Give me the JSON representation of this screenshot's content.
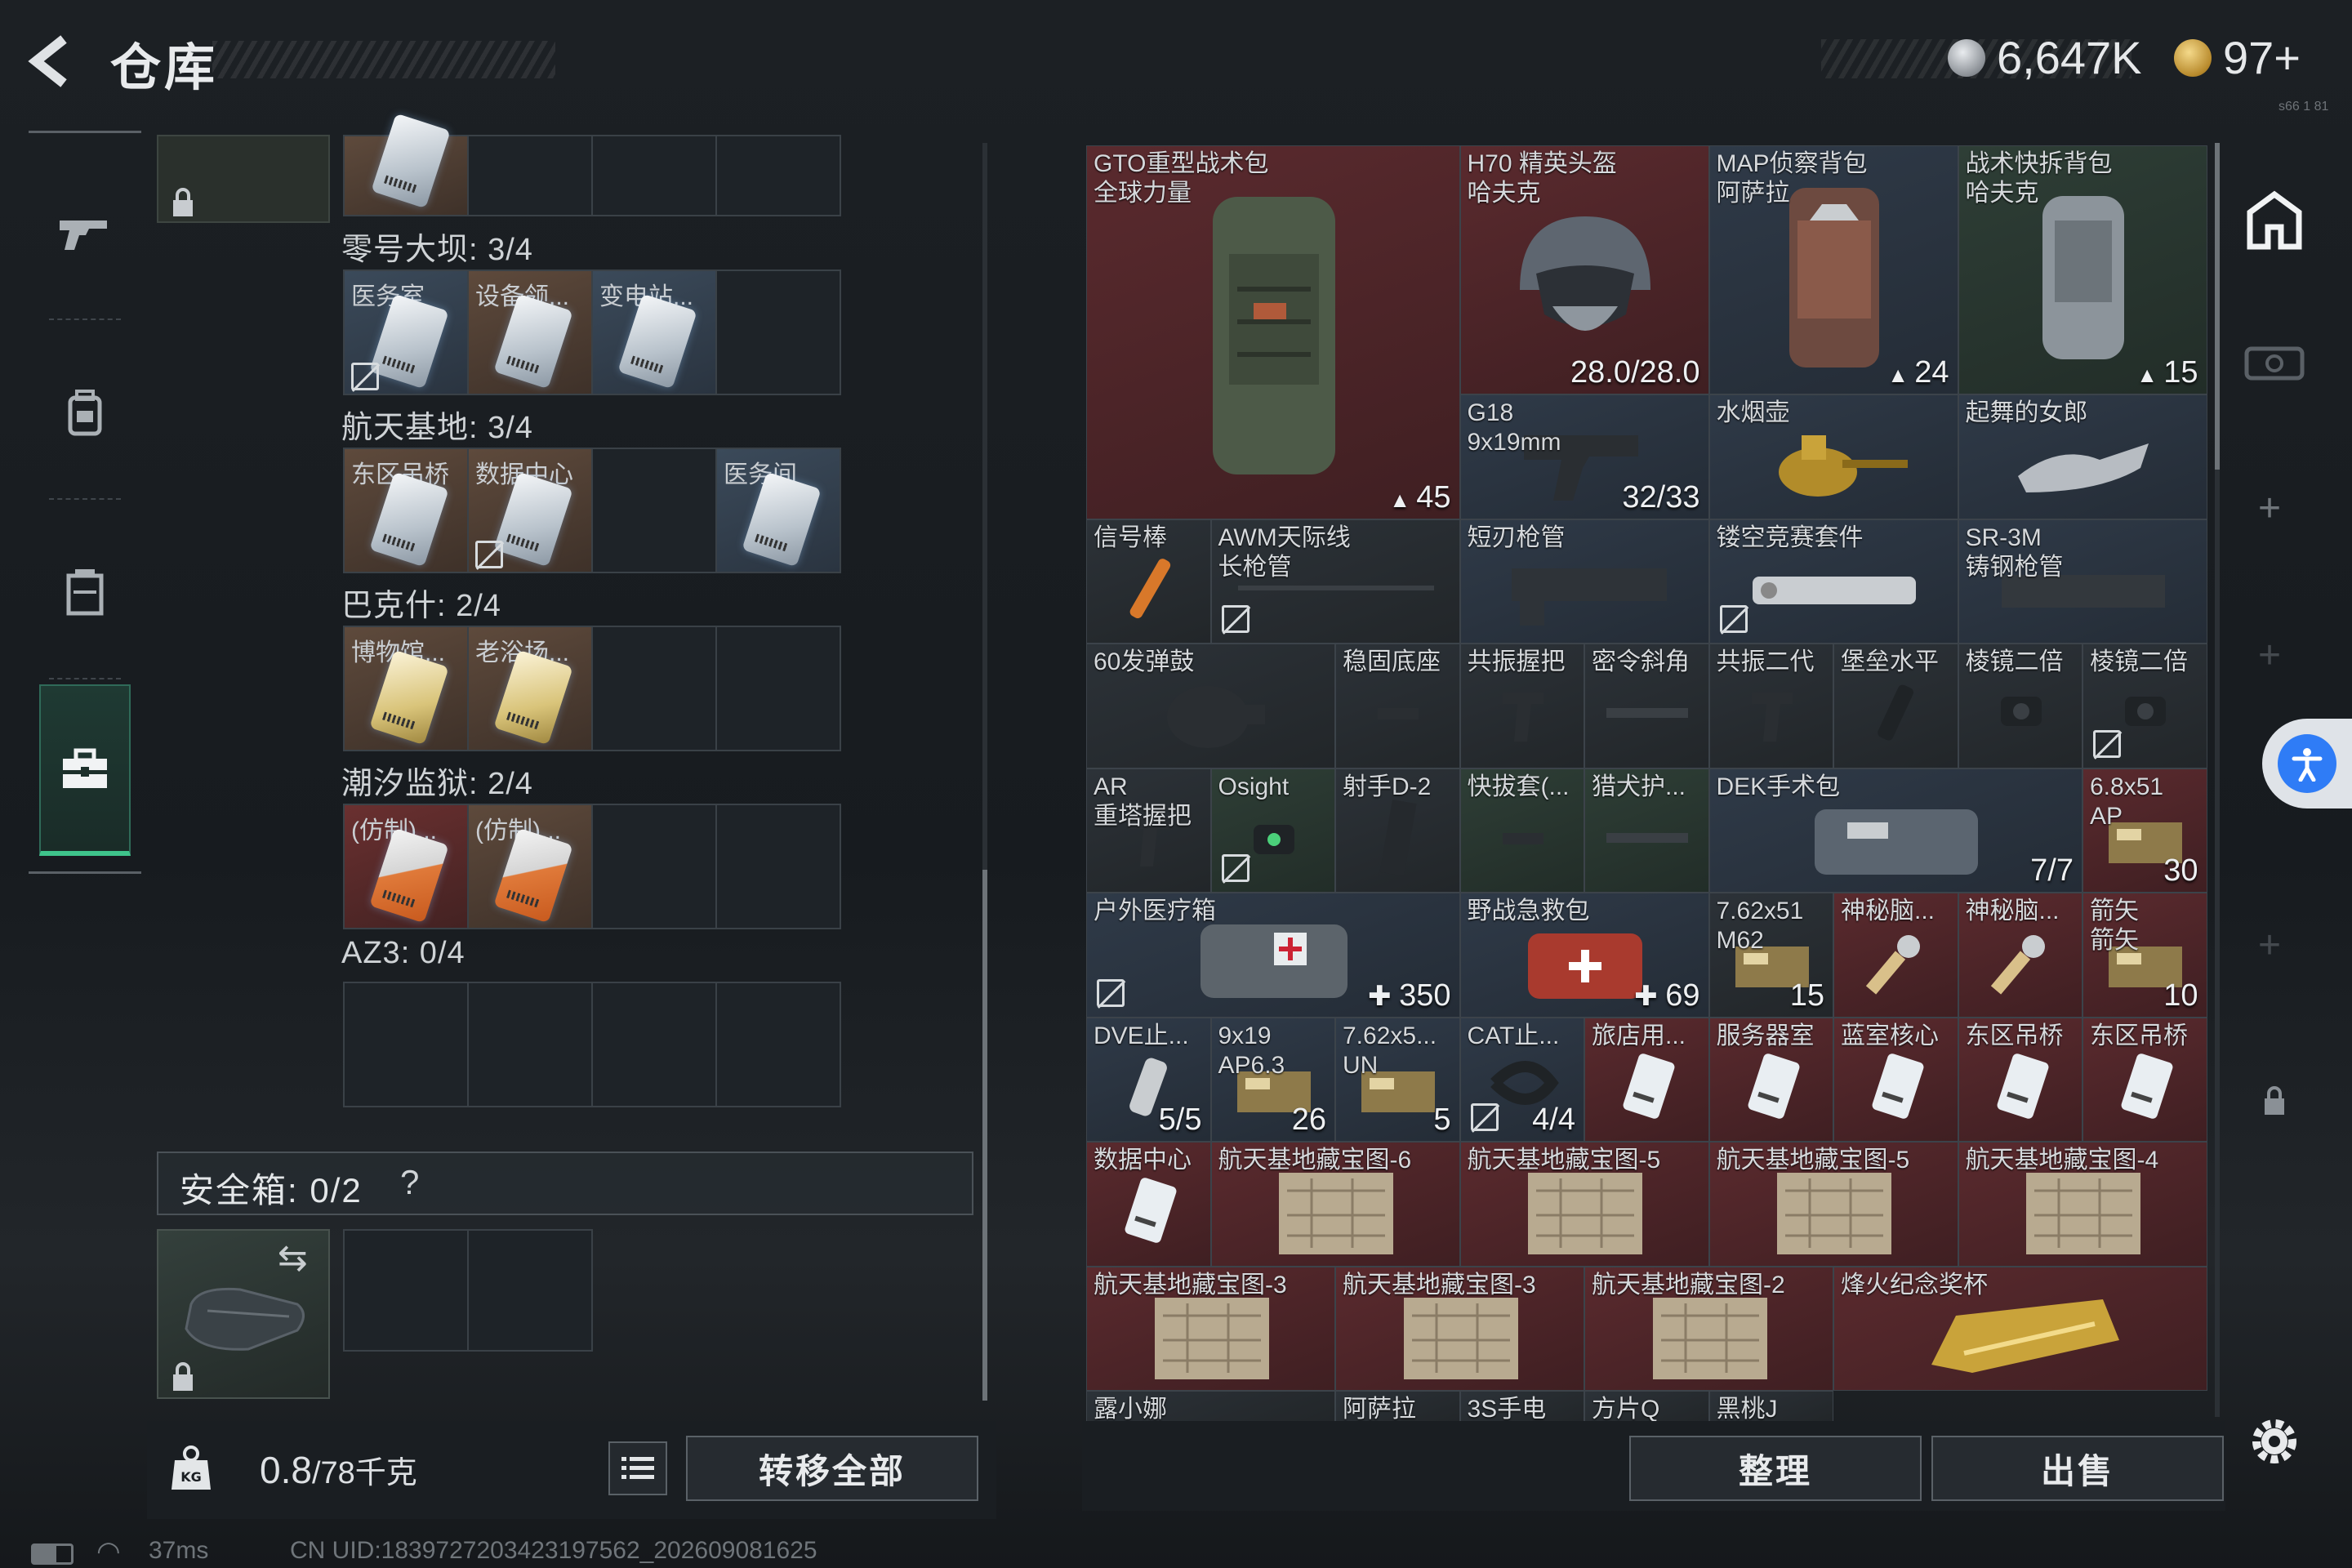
{
  "header": {
    "title": "仓库",
    "currency_silver": "6,647K",
    "currency_gold": "97+",
    "version": "s66 1 81",
    "silver_color": "#b7bcc2",
    "gold_color": "#d8a637"
  },
  "nav": {
    "items": [
      {
        "name": "weapons",
        "icon": "gun-icon"
      },
      {
        "name": "gear",
        "icon": "backpack-icon"
      },
      {
        "name": "armor",
        "icon": "vest-icon"
      },
      {
        "name": "keys",
        "icon": "toolbox-icon",
        "active": true
      }
    ],
    "active_color": "#3ec48b"
  },
  "key_panel": {
    "sections": [
      {
        "title": "零号大坝: 3/4",
        "slots": [
          "医务室",
          "设备领...",
          "变电站..."
        ]
      },
      {
        "title": "航天基地: 3/4",
        "slots": [
          "东区吊桥",
          "数据中心",
          "",
          "医务间"
        ]
      },
      {
        "title": "巴克什: 2/4",
        "slots": [
          "博物馆...",
          "老浴场..."
        ]
      },
      {
        "title": "潮汐监狱: 2/4",
        "slots": [
          "(仿制)...",
          "(仿制)..."
        ]
      },
      {
        "title": "AZ3: 0/4",
        "slots": []
      }
    ],
    "safe_box": "安全箱: 0/2",
    "help": "?"
  },
  "footer_left": {
    "weight_value": "0.8",
    "weight_unit": "/78千克",
    "weight_icon_label": "KG",
    "transfer_all": "转移全部"
  },
  "status_bar": {
    "ping": "37ms",
    "uid": "CN UID:1839727203423197562_202609081625"
  },
  "inventory": {
    "items": [
      {
        "name": "GTO重型战术包\n全球力量",
        "count": "45",
        "theme": "red"
      },
      {
        "name": "H70 精英头盔\n哈夫克",
        "count": "28.0/28.0",
        "theme": "red"
      },
      {
        "name": "MAP侦察背包\n阿萨拉",
        "count": "24",
        "theme": "blue"
      },
      {
        "name": "战术快拆背包\n哈夫克",
        "count": "15",
        "theme": "green"
      },
      {
        "name": "G18\n9x19mm",
        "count": "32/33",
        "theme": "blue"
      },
      {
        "name": "水烟壶",
        "count": "",
        "theme": "blue"
      },
      {
        "name": "起舞的女郎",
        "count": "",
        "theme": "blue"
      },
      {
        "name": "信号棒",
        "count": "",
        "theme": "gray"
      },
      {
        "name": "AWM天际线\n长枪管",
        "count": "",
        "theme": "gray"
      },
      {
        "name": "短刃枪管",
        "count": "",
        "theme": "blue"
      },
      {
        "name": "镂空竞赛套件",
        "count": "",
        "theme": "blue"
      },
      {
        "name": "SR-3M\n铸钢枪管",
        "count": "",
        "theme": "blue"
      },
      {
        "name": "60发弹鼓",
        "count": "",
        "theme": "gray"
      },
      {
        "name": "稳固底座",
        "count": "",
        "theme": "gray"
      },
      {
        "name": "共振握把",
        "count": "",
        "theme": "gray"
      },
      {
        "name": "密令斜角",
        "count": "",
        "theme": "gray"
      },
      {
        "name": "共振二代",
        "count": "",
        "theme": "gray"
      },
      {
        "name": "堡垒水平",
        "count": "",
        "theme": "gray"
      },
      {
        "name": "棱镜二倍",
        "count": "",
        "theme": "gray"
      },
      {
        "name": "棱镜二倍",
        "count": "",
        "theme": "gray"
      },
      {
        "name": "AR\n重塔握把",
        "count": "",
        "theme": "gray"
      },
      {
        "name": "Osight",
        "count": "",
        "theme": "green"
      },
      {
        "name": "射手D-2",
        "count": "",
        "theme": "gray"
      },
      {
        "name": "快拔套(...",
        "count": "",
        "theme": "green"
      },
      {
        "name": "猎犬护...",
        "count": "",
        "theme": "green"
      },
      {
        "name": "DEK手术包",
        "count": "7/7",
        "theme": "blue"
      },
      {
        "name": "6.8x51\nAP",
        "count": "30",
        "theme": "red"
      },
      {
        "name": "户外医疗箱",
        "count": "350",
        "theme": "blue"
      },
      {
        "name": "野战急救包",
        "count": "69",
        "theme": "blue"
      },
      {
        "name": "7.62x51\nM62",
        "count": "15",
        "theme": "gray"
      },
      {
        "name": "神秘脑...",
        "count": "",
        "theme": "red"
      },
      {
        "name": "神秘脑...",
        "count": "",
        "theme": "red"
      },
      {
        "name": "箭矢\n箭矢",
        "count": "10",
        "theme": "red"
      },
      {
        "name": "DVE止...",
        "count": "5/5",
        "theme": "blue"
      },
      {
        "name": "9x19\nAP6.3",
        "count": "26",
        "theme": "blue"
      },
      {
        "name": "7.62x5...\nUN",
        "count": "5",
        "theme": "blue"
      },
      {
        "name": "CAT止...",
        "count": "4/4",
        "theme": "blue"
      },
      {
        "name": "旅店用...",
        "count": "",
        "theme": "red"
      },
      {
        "name": "服务器室",
        "count": "",
        "theme": "red"
      },
      {
        "name": "蓝室核心",
        "count": "",
        "theme": "red"
      },
      {
        "name": "东区吊桥",
        "count": "",
        "theme": "red"
      },
      {
        "name": "东区吊桥",
        "count": "",
        "theme": "red"
      },
      {
        "name": "数据中心",
        "count": "",
        "theme": "red"
      },
      {
        "name": "航天基地藏宝图-6",
        "count": "",
        "theme": "red"
      },
      {
        "name": "航天基地藏宝图-5",
        "count": "",
        "theme": "red"
      },
      {
        "name": "航天基地藏宝图-5",
        "count": "",
        "theme": "red"
      },
      {
        "name": "航天基地藏宝图-4",
        "count": "",
        "theme": "red"
      },
      {
        "name": "航天基地藏宝图-3",
        "count": "",
        "theme": "red"
      },
      {
        "name": "航天基地藏宝图-3",
        "count": "",
        "theme": "red"
      },
      {
        "name": "航天基地藏宝图-2",
        "count": "",
        "theme": "red"
      },
      {
        "name": "烽火纪念奖杯",
        "count": "",
        "theme": "red"
      },
      {
        "name": "露小娜",
        "count": "",
        "theme": "gray"
      },
      {
        "name": "阿萨拉牌...",
        "count": "",
        "theme": "gray"
      },
      {
        "name": "3S手电",
        "count": "",
        "theme": "gray"
      },
      {
        "name": "方片Q",
        "count": "",
        "theme": "gray"
      },
      {
        "name": "黑桃J",
        "count": "",
        "theme": "gray"
      }
    ],
    "sort": "整理",
    "sell": "出售"
  },
  "rail": {
    "icons": [
      "exit-icon",
      "vr-icon",
      "add-icon",
      "add-icon",
      "add-icon",
      "lock-icon",
      "settings-icon"
    ]
  }
}
